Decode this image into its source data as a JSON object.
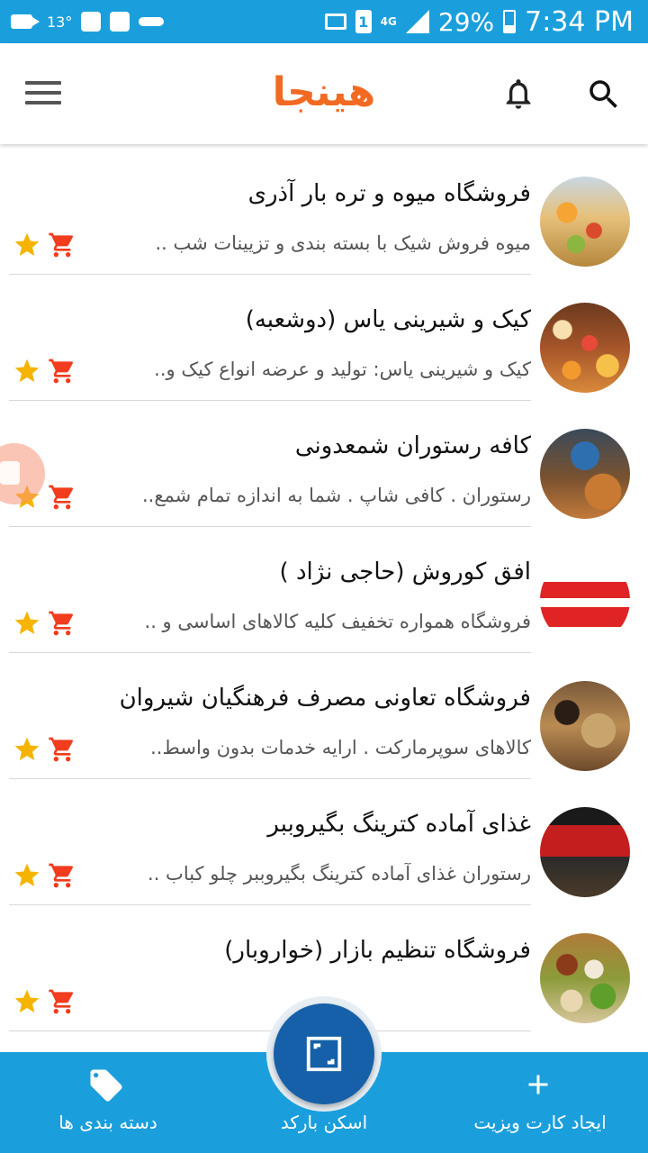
{
  "status_bar": {
    "temperature": "13°",
    "network": "4G",
    "sim_slot": "1",
    "battery": "29%",
    "time": "7:34 PM"
  },
  "app_bar": {
    "logo_text": "هینجا",
    "logo_color": "#f26a21",
    "icons": [
      "menu-icon",
      "bell-icon",
      "search-icon"
    ]
  },
  "listings": [
    {
      "title": "فروشگاه میوه و تره بار  آذری",
      "description": "میوه فروش شیک با بسته بندی و تزیینات شب ..",
      "avatar": "fruit-shop"
    },
    {
      "title": "کیک و شیرینی یاس (دوشعبه)",
      "description": "کیک و شیرینی یاس: تولید و عرضه انواع کیک و..",
      "avatar": "pastry-display"
    },
    {
      "title": "کافه رستوران شمعدونی",
      "description": "رستوران . کافی شاپ .  شما به اندازه تمام شمع..",
      "avatar": "cafe-interior"
    },
    {
      "title": "افق کوروش (حاجی نژاد )",
      "description": "فروشگاه همواره تخفیف کلیه کالاهای اساسی و ..",
      "avatar": "ofogh-kourosh-logo"
    },
    {
      "title": "فروشگاه تعاونی مصرف فرهنگیان شیروان",
      "description": "کالاهای سوپرمارکت .   ارایه خدمات بدون واسط..",
      "avatar": "supermarket-aisle"
    },
    {
      "title": "غذای آماده کترینگ بگیروببر",
      "description": "رستوران غذای آماده کترینگ بگیروببر چلو کباب ..",
      "avatar": "catering-sign"
    },
    {
      "title": "فروشگاه تنظیم بازار (خواروبار)",
      "description": "",
      "avatar": "groceries"
    }
  ],
  "bottom_nav": {
    "create_card": "ایجاد کارت ویزیت",
    "scan_barcode": "اسکن بارکد",
    "categories": "دسته بندی ها"
  },
  "colors": {
    "primary": "#1b9fdc",
    "fab": "#1560a8",
    "accent": "#f26a21",
    "star": "#f5b400",
    "cart": "#f23c1e"
  }
}
